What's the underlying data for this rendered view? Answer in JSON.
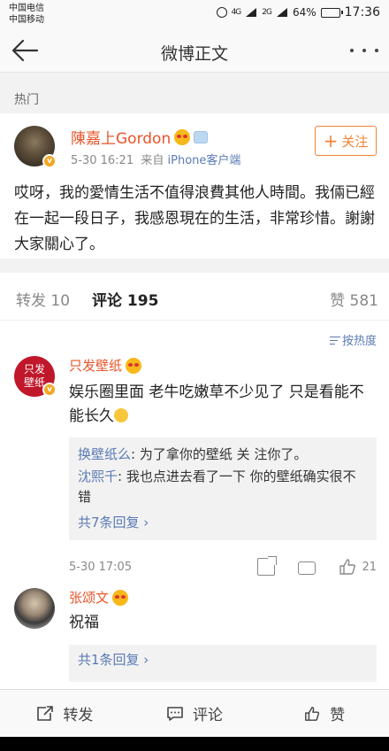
{
  "status": {
    "carrier1": "中国电信",
    "carrier2": "中国移动",
    "signal1": "4G",
    "signal2": "2G",
    "battery": "64%",
    "battery_level": 0.64,
    "time": "17:36"
  },
  "nav": {
    "title": "微博正文"
  },
  "section": {
    "hot": "热门"
  },
  "post": {
    "author": "陳嘉上Gordon",
    "time": "5-30 16:21",
    "source_prefix": "来自",
    "source": "iPhone客户端",
    "follow_label": "关注",
    "follow_plus": "+",
    "text": "哎呀，我的愛情生活不值得浪費其他人時間。我倆已經在一起一段日子，我感恩現在的生活，非常珍惜。謝謝大家關心了。"
  },
  "tabs": {
    "repost_label": "转发",
    "repost_count": "10",
    "comment_label": "评论",
    "comment_count": "195",
    "like_label": "赞",
    "like_count": "581"
  },
  "sort": {
    "label": "按热度"
  },
  "comments": [
    {
      "name": "只发壁纸",
      "avatar_text": "只发壁纸",
      "text": "娱乐圈里面 老牛吃嫩草不少见了 只是看能不能长久",
      "replies": [
        {
          "user": "换壁纸么",
          "text": ": 为了拿你的壁纸 关 注你了。"
        },
        {
          "user": "沈熙千",
          "text": ": 我也点进去看了一下 你的壁纸确实很不错"
        }
      ],
      "more": "共7条回复 ›",
      "time": "5-30 17:05",
      "likes": "21"
    },
    {
      "name": "张颂文",
      "text": "祝福",
      "more": "共1条回复 ›"
    }
  ],
  "bottom": {
    "repost": "转发",
    "comment": "评论",
    "like": "赞"
  },
  "colors": {
    "accent": "#f28436",
    "name": "#e8542a",
    "link": "#5a7bb4"
  }
}
